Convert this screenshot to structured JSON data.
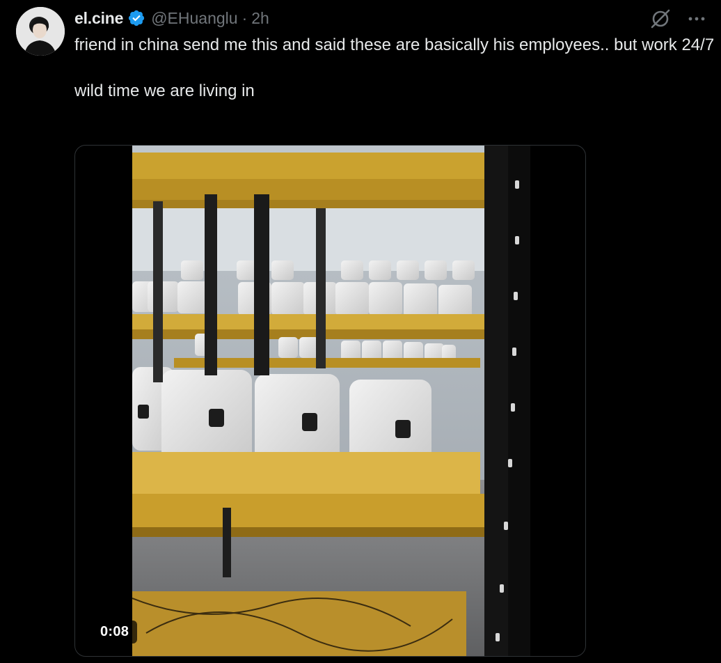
{
  "user": {
    "display_name": "el.cine",
    "handle": "@EHuanglu",
    "separator": "·",
    "time": "2h",
    "verified": true
  },
  "tweet": {
    "line1": "friend in china send me this and said these are basically his employees.. but work 24/7",
    "line2": "wild time we are living in"
  },
  "media": {
    "type": "video",
    "duration": "0:08"
  },
  "icons": {
    "verified": "verified-badge-icon",
    "grok": "grok-icon",
    "more": "more-icon"
  },
  "colors": {
    "background": "#000000",
    "text": "#e7e9ea",
    "secondary": "#71767b",
    "verified": "#1d9bf0",
    "border": "#2f3336"
  }
}
